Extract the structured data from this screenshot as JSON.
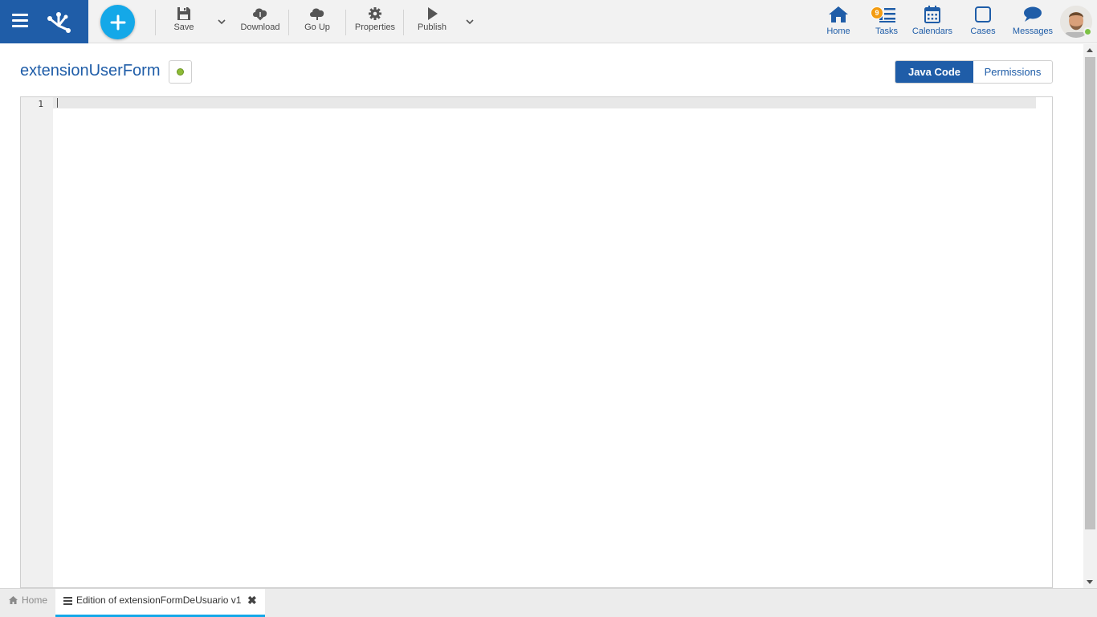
{
  "toolbar": {
    "save_label": "Save",
    "download_label": "Download",
    "goup_label": "Go Up",
    "properties_label": "Properties",
    "publish_label": "Publish"
  },
  "nav": {
    "home_label": "Home",
    "tasks_label": "Tasks",
    "tasks_badge": "9",
    "calendars_label": "Calendars",
    "cases_label": "Cases",
    "messages_label": "Messages"
  },
  "page": {
    "title": "extensionUserForm"
  },
  "tabs": {
    "java_code": "Java Code",
    "permissions": "Permissions",
    "active": "Java Code"
  },
  "editor": {
    "lines": [
      "1"
    ]
  },
  "bottom_tabs": {
    "home_label": "Home",
    "doc_label": "Edition of extensionFormDeUsuario v1"
  },
  "colors": {
    "brand": "#1f5da8",
    "accent": "#14a8e8",
    "badge": "#f39c12",
    "online": "#7cc244",
    "status_dot": "#8dbb35"
  },
  "icons": [
    "menu-icon",
    "logo-icon",
    "plus-icon",
    "save-icon",
    "chevron-down-icon",
    "download-icon",
    "upload-icon",
    "gear-icon",
    "play-icon",
    "home-icon",
    "tasks-icon",
    "calendar-icon",
    "cases-icon",
    "messages-icon",
    "close-icon"
  ]
}
